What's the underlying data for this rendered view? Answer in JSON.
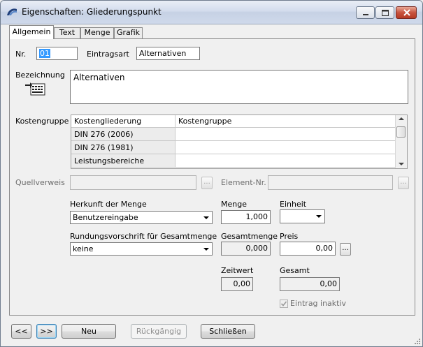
{
  "window": {
    "title": "Eigenschaften: Gliederungspunkt"
  },
  "tabs": [
    {
      "label": "Allgemein",
      "active": true
    },
    {
      "label": "Text",
      "active": false
    },
    {
      "label": "Menge",
      "active": false
    },
    {
      "label": "Grafik",
      "active": false
    }
  ],
  "form": {
    "nr_label": "Nr.",
    "nr_value": "01",
    "eintragsart_label": "Eintragsart",
    "eintragsart_value": "Alternativen",
    "bezeichnung_label": "Bezeichnung",
    "bezeichnung_value": "Alternativen",
    "kostengruppe_label": "Kostengruppe",
    "quellverweis_label": "Quellverweis",
    "quellverweis_value": "",
    "element_nr_label": "Element-Nr.",
    "element_nr_value": "",
    "herkunft_label": "Herkunft der Menge",
    "herkunft_value": "Benutzereingabe",
    "menge_label": "Menge",
    "menge_value": "1,000",
    "einheit_label": "Einheit",
    "einheit_value": "",
    "rundung_label": "Rundungsvorschrift für Gesamtmenge",
    "rundung_value": "keine",
    "gesamtmenge_label": "Gesamtmenge",
    "gesamtmenge_value": "0,000",
    "preis_label": "Preis",
    "preis_value": "0,00",
    "zeitwert_label": "Zeitwert",
    "zeitwert_value": "0,00",
    "gesamt_label": "Gesamt",
    "gesamt_value": "0,00",
    "eintrag_inaktiv_label": "Eintrag inaktiv",
    "eintrag_inaktiv_checked": true,
    "dots_label": "..."
  },
  "kostengruppe_table": {
    "columns": [
      "Kostengliederung",
      "Kostengruppe"
    ],
    "rows": [
      [
        "DIN 276 (2006)",
        ""
      ],
      [
        "DIN 276 (1981)",
        ""
      ],
      [
        "Leistungsbereiche",
        ""
      ]
    ]
  },
  "footer": {
    "prev_label": "<<",
    "next_label": ">>",
    "neu_label": "Neu",
    "rueckgaengig_label": "Rückgängig",
    "schliessen_label": "Schließen"
  },
  "colors": {
    "selection": "#3399ff",
    "titlebar": "#d3dced",
    "close_button": "#c8533e"
  }
}
